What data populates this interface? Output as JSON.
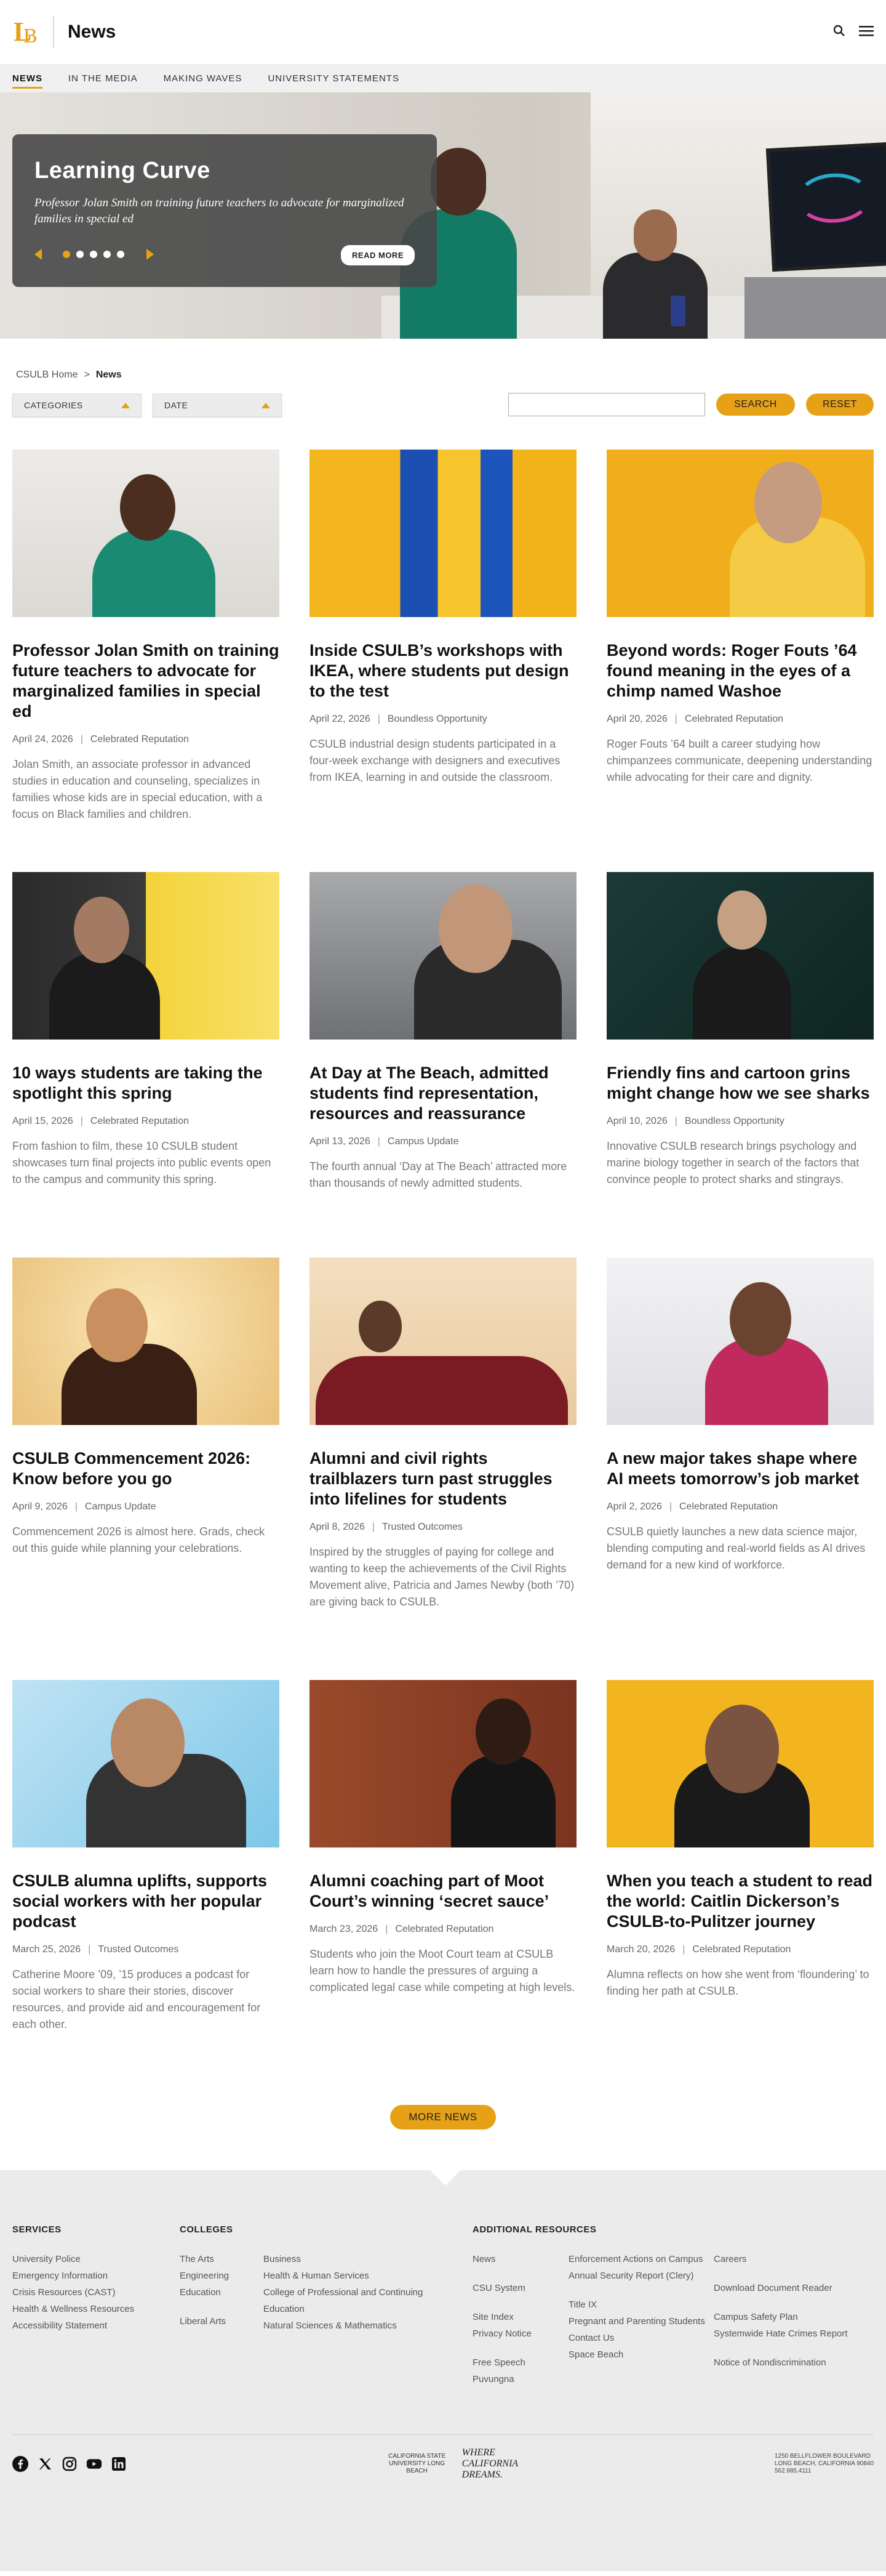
{
  "header": {
    "logo_letters": "LB",
    "title": "News",
    "search_icon": "search-icon",
    "menu_icon": "hamburger-menu-icon"
  },
  "nav": {
    "items": [
      "NEWS",
      "IN THE MEDIA",
      "MAKING WAVES",
      "UNIVERSITY STATEMENTS"
    ]
  },
  "hero": {
    "title": "Learning Curve",
    "subtitle": "Professor Jolan Smith on training future teachers to advocate for marginalized families in special ed",
    "read_more": "READ MORE",
    "slide_count": 5,
    "active_slide": 1
  },
  "breadcrumb": {
    "home": "CSULB Home",
    "separator": ">",
    "current": "News"
  },
  "filters": {
    "categories": "CATEGORIES",
    "date": "DATE",
    "search_value": "",
    "search_button": "SEARCH",
    "reset_button": "RESET"
  },
  "articles": [
    {
      "title": "Professor Jolan Smith on training future teachers to advocate for marginalized families in special ed",
      "date": "April 24, 2026",
      "category": "Celebrated Reputation",
      "desc": "Jolan Smith, an associate professor in advanced studies in education and counseling, specializes in families whose kids are in special education, with a focus on Black families and children."
    },
    {
      "title": "Inside CSULB’s workshops with IKEA, where students put design to the test",
      "date": "April 22, 2026",
      "category": "Boundless Opportunity",
      "desc": "CSULB industrial design students participated in a four-week exchange with designers and executives from IKEA, learning in and outside the classroom."
    },
    {
      "title": "Beyond words: Roger Fouts ’64 found meaning in the eyes of a chimp named Washoe",
      "date": "April 20, 2026",
      "category": "Celebrated Reputation",
      "desc": "Roger Fouts ’64 built a career studying how chimpanzees communicate, deepening understanding while advocating for their care and dignity."
    },
    {
      "title": "10 ways students are taking the spotlight this spring",
      "date": "April 15, 2026",
      "category": "Celebrated Reputation",
      "desc": "From fashion to film, these 10 CSULB student showcases turn final projects into public events open to the campus and community this spring."
    },
    {
      "title": "At Day at The Beach, admitted students find representation, resources and reassurance",
      "date": "April 13, 2026",
      "category": "Campus Update",
      "desc": "The fourth annual ‘Day at The Beach’ attracted more than thousands of newly admitted students."
    },
    {
      "title": "Friendly fins and cartoon grins might change how we see sharks",
      "date": "April 10, 2026",
      "category": "Boundless Opportunity",
      "desc": "Innovative CSULB research brings psychology and marine biology together in search of the factors that convince people to protect sharks and stingrays."
    },
    {
      "title": "CSULB Commencement 2026: Know before you go",
      "date": "April 9, 2026",
      "category": "Campus Update",
      "desc": "Commencement 2026 is almost here. Grads, check out this guide while planning your celebrations."
    },
    {
      "title": "Alumni and civil rights trailblazers turn past struggles into lifelines for students",
      "date": "April 8, 2026",
      "category": "Trusted Outcomes",
      "desc": "Inspired by the struggles of paying for college and wanting to keep the achievements of the Civil Rights Movement alive, Patricia and James Newby (both ’70) are giving back to CSULB."
    },
    {
      "title": "A new major takes shape where AI meets tomorrow’s job market",
      "date": "April 2, 2026",
      "category": "Celebrated Reputation",
      "desc": "CSULB quietly launches a new data science major, blending computing and real-world fields as AI drives demand for a new kind of workforce."
    },
    {
      "title": "CSULB alumna uplifts, supports social workers with her popular podcast",
      "date": "March 25, 2026",
      "category": "Trusted Outcomes",
      "desc": "Catherine Moore ’09, ’15 produces a podcast for social workers to share their stories, discover resources, and provide aid and encouragement for each other."
    },
    {
      "title": "Alumni coaching part of Moot Court’s winning ‘secret sauce’",
      "date": "March 23, 2026",
      "category": "Celebrated Reputation",
      "desc": "Students who join the Moot Court team at CSULB learn how to handle the pressures of arguing a complicated legal case while competing at high levels."
    },
    {
      "title": "When you teach a student to read the world: Caitlin Dickerson’s CSULB-to-Pulitzer journey",
      "date": "March 20, 2026",
      "category": "Celebrated Reputation",
      "desc": "Alumna reflects on how she went from ‘floundering’ to finding her path at CSULB."
    }
  ],
  "more_news": "MORE NEWS",
  "footer": {
    "services": {
      "heading": "SERVICES",
      "links": [
        "University Police",
        "Emergency Information",
        "Crisis Resources (CAST)",
        "Health & Wellness Resources",
        "Accessibility Statement"
      ]
    },
    "colleges": {
      "heading": "COLLEGES",
      "col1": [
        "The Arts",
        "Engineering",
        "Education",
        "Liberal Arts"
      ],
      "col2": [
        "Business",
        "Health & Human Services",
        "College of Professional and Continuing Education",
        "Natural Sciences & Mathematics"
      ]
    },
    "additional": {
      "heading": "ADDITIONAL RESOURCES",
      "col1": [
        "News",
        "CSU System",
        "Site Index",
        "Privacy Notice",
        "Free Speech",
        "Puvungna"
      ],
      "col2": [
        "Enforcement Actions on Campus",
        "Annual Security Report (Clery)",
        "Title IX",
        "Pregnant and Parenting Students",
        "Contact Us",
        "Space Beach"
      ],
      "col3": [
        "Careers",
        "Download Document Reader",
        "Campus Safety Plan",
        "Systemwide Hate Crimes Report",
        "Notice of Nondiscrimination"
      ]
    },
    "social_icons": [
      "facebook-icon",
      "x-icon",
      "instagram-icon",
      "youtube-icon",
      "linkedin-icon"
    ],
    "mini_logo": "CALIFORNIA STATE UNIVERSITY LONG BEACH",
    "tagline": [
      "WHERE",
      "CALIFORNIA",
      "DREAMS."
    ],
    "address": [
      "1250 BELLFLOWER BOULEVARD",
      "LONG BEACH, CALIFORNIA 90840",
      "562.985.4111"
    ]
  },
  "colors": {
    "accent": "#e6a117",
    "footer_bg": "#ebebeb",
    "nav_bg": "#f0f0f0"
  }
}
